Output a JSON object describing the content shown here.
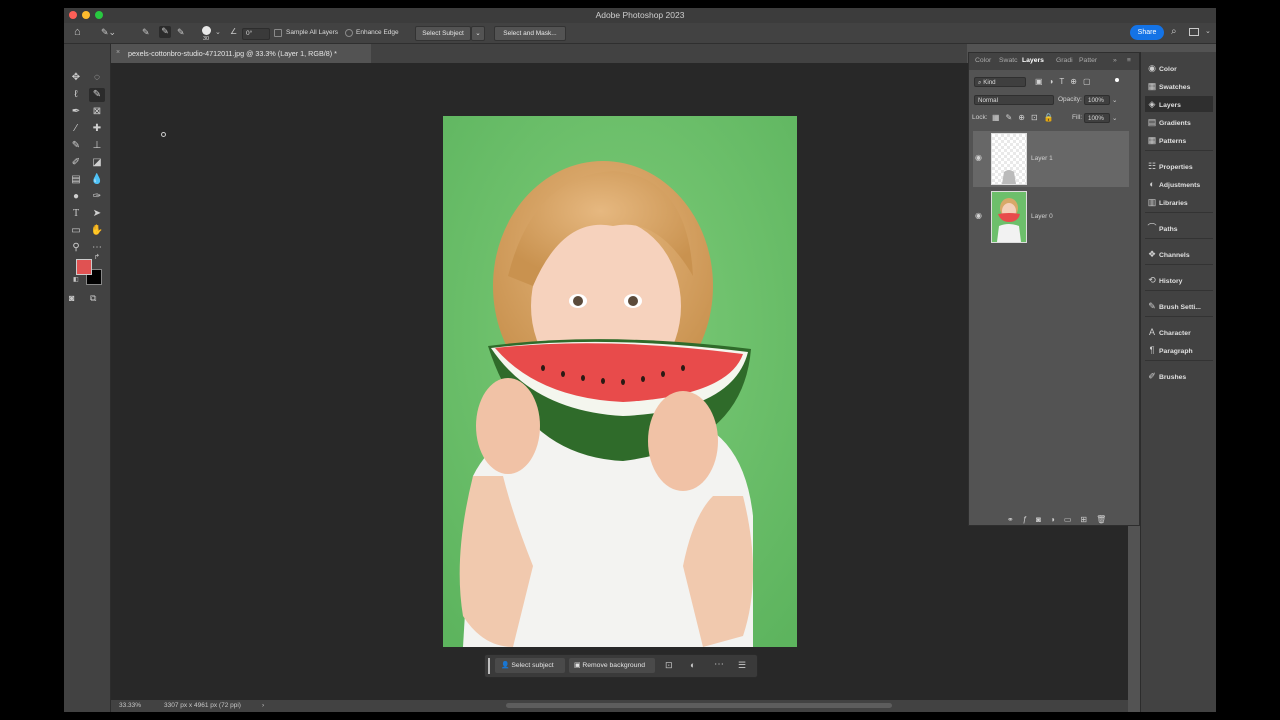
{
  "app": {
    "window_title": "Adobe Photoshop 2023",
    "share_label": "Share"
  },
  "options_bar": {
    "brush_size": "30",
    "angle": "0°",
    "sample_all_layers": "Sample All Layers",
    "enhance_edge": "Enhance Edge",
    "select_subject": "Select Subject",
    "select_and_mask": "Select and Mask..."
  },
  "document": {
    "tab_title": "pexels-cottonbro-studio-4712011.jpg @ 33.3% (Layer 1, RGB/8) *",
    "zoom": "33.33%",
    "dimensions": "3307 px x 4961 px (72 ppi)"
  },
  "colors": {
    "foreground": "#e05252",
    "background": "#000000",
    "accent": "#1473e6"
  },
  "contextual_taskbar": {
    "select_subject": "Select subject",
    "remove_background": "Remove background"
  },
  "layers_panel": {
    "tabs": [
      "Color",
      "Swatc",
      "Layers",
      "Gradi",
      "Patter"
    ],
    "active_tab": "Layers",
    "filter_kind": "Kind",
    "blend_mode": "Normal",
    "opacity_label": "Opacity:",
    "opacity_value": "100%",
    "lock_label": "Lock:",
    "fill_label": "Fill:",
    "fill_value": "100%",
    "layers": [
      {
        "name": "Layer 1",
        "visible": true,
        "selected": true
      },
      {
        "name": "Layer 0",
        "visible": true,
        "selected": false
      }
    ]
  },
  "dock": {
    "items": [
      {
        "label": "Color",
        "icon": "color-wheel-icon"
      },
      {
        "label": "Swatches",
        "icon": "swatches-grid-icon"
      },
      {
        "label": "Layers",
        "icon": "layers-icon"
      },
      {
        "label": "Gradients",
        "icon": "gradient-icon"
      },
      {
        "label": "Patterns",
        "icon": "patterns-icon"
      },
      {
        "label": "Properties",
        "icon": "sliders-icon"
      },
      {
        "label": "Adjustments",
        "icon": "adjustments-icon"
      },
      {
        "label": "Libraries",
        "icon": "libraries-icon"
      },
      {
        "label": "Paths",
        "icon": "paths-icon"
      },
      {
        "label": "Channels",
        "icon": "channels-icon"
      },
      {
        "label": "History",
        "icon": "history-icon"
      },
      {
        "label": "Brush Setti...",
        "icon": "brush-settings-icon"
      },
      {
        "label": "Character",
        "icon": "character-icon"
      },
      {
        "label": "Paragraph",
        "icon": "paragraph-icon"
      },
      {
        "label": "Brushes",
        "icon": "brushes-icon"
      }
    ],
    "active": "Layers"
  }
}
